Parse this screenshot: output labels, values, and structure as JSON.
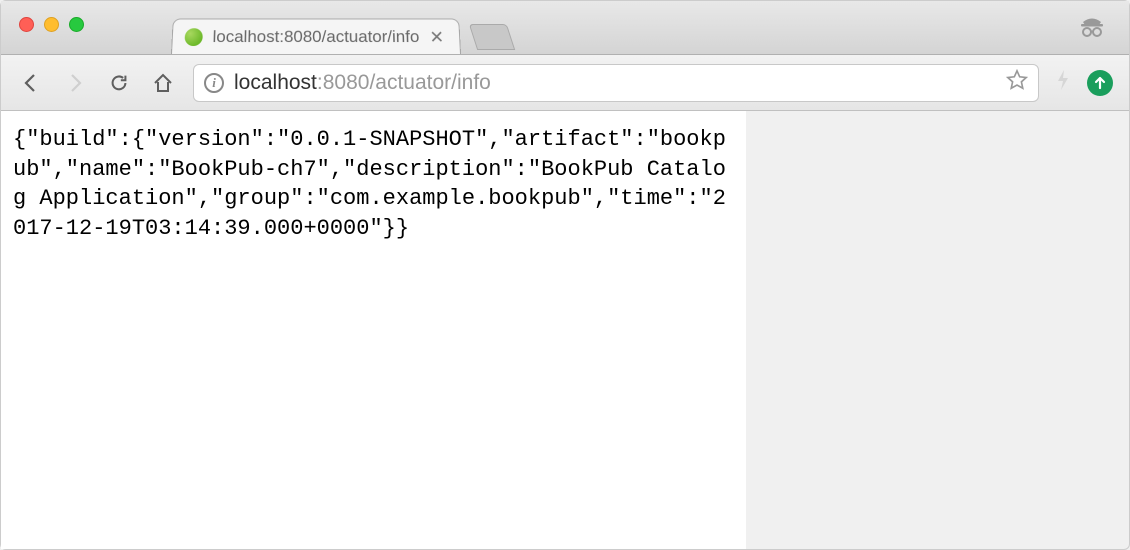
{
  "tab": {
    "title": "localhost:8080/actuator/info"
  },
  "addressbar": {
    "host": "localhost",
    "path": ":8080/actuator/info"
  },
  "page": {
    "body": "{\"build\":{\"version\":\"0.0.1-SNAPSHOT\",\"artifact\":\"bookpub\",\"name\":\"BookPub-ch7\",\"description\":\"BookPub Catalog Application\",\"group\":\"com.example.bookpub\",\"time\":\"2017-12-19T03:14:39.000+0000\"}}"
  }
}
